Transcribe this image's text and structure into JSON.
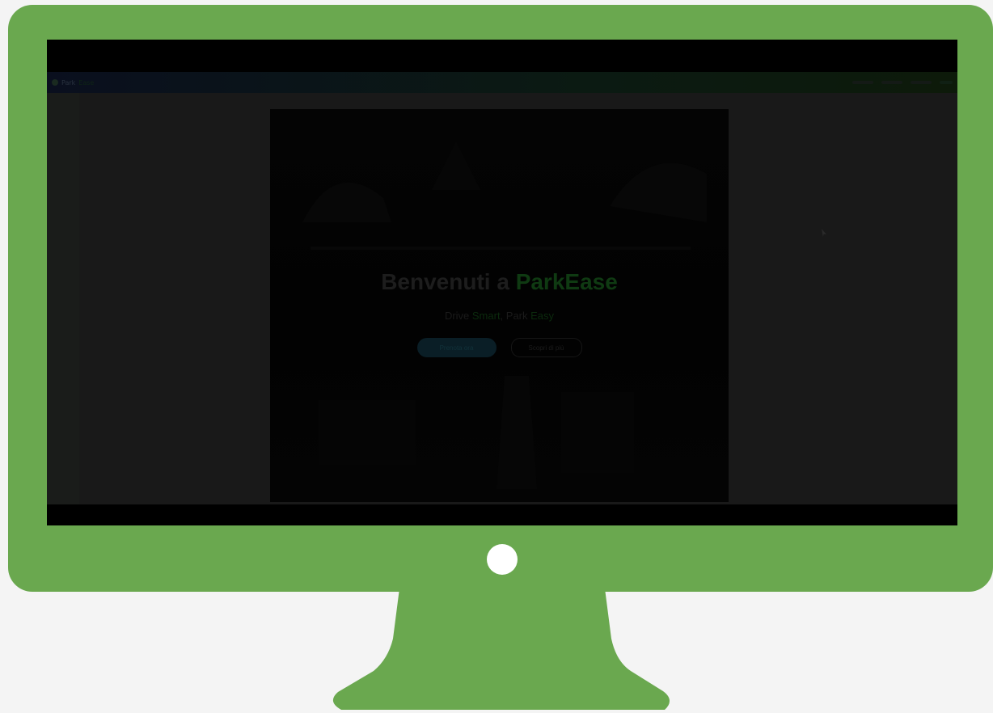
{
  "colors": {
    "bezel": "#6aa84f",
    "screen": "#000000",
    "background": "#f4f4f4",
    "accent": "#0f3a12"
  },
  "navbar": {
    "brand": "Park",
    "brand_accent": "Ease",
    "links": [
      "",
      "",
      ""
    ]
  },
  "hero": {
    "title_prefix": "Benvenuti a ",
    "title_accent": "ParkEase",
    "subtitle_prefix": "Drive ",
    "subtitle_accent": "Smart",
    "subtitle_mid": ", Park ",
    "subtitle_suffix": "Easy",
    "primary_button": "Prenota ora",
    "secondary_button": "Scopri di più"
  },
  "icons": {
    "power": "power-button-icon",
    "logo": "parking-logo-icon",
    "cursor": "mouse-cursor-icon"
  }
}
